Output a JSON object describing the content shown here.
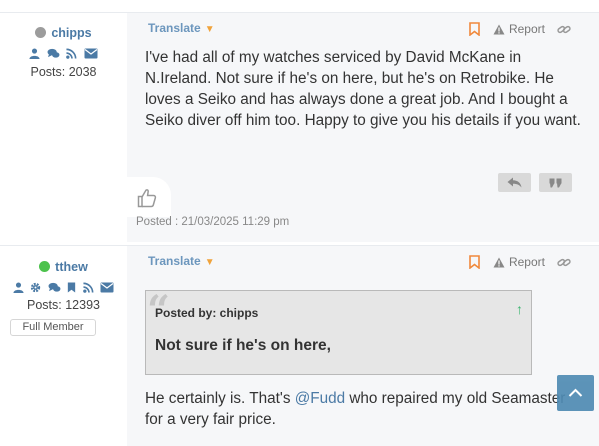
{
  "posts": [
    {
      "author": {
        "username": "chipps",
        "status": "offline",
        "icons": [
          "profile-icon",
          "messages-icon",
          "rss-icon",
          "email-icon"
        ],
        "posts_label": "Posts: 2038"
      },
      "translate_label": "Translate",
      "report_label": "Report",
      "body": "I've had all of my watches serviced by David McKane in N.Ireland. Not sure if he's on here, but he's on Retrobike. He loves a Seiko and has always done a great job. And I bought a Seiko diver off him too. Happy to give you his details if you want.",
      "posted": "Posted : 21/03/2025 11:29 pm"
    },
    {
      "author": {
        "username": "tthew",
        "status": "online",
        "icons": [
          "profile-icon",
          "gear-icon",
          "messages-icon",
          "bookmark-icon",
          "rss-icon",
          "email-icon"
        ],
        "posts_label": "Posts: 12393",
        "rank": "Full Member"
      },
      "translate_label": "Translate",
      "report_label": "Report",
      "quote": {
        "by": "Posted by: chipps",
        "text": "Not sure if he's on here,"
      },
      "body_before": "He certainly is. That's ",
      "mention": "@Fudd",
      "body_after": " who repaired my old Seamaster for a very fair price."
    }
  ],
  "colors": {
    "link": "#4b7aa5",
    "online": "#4cc24c",
    "offline": "#9c9c9c",
    "bookmark": "#f0893c",
    "scroll_top": "#4f8bb3"
  }
}
